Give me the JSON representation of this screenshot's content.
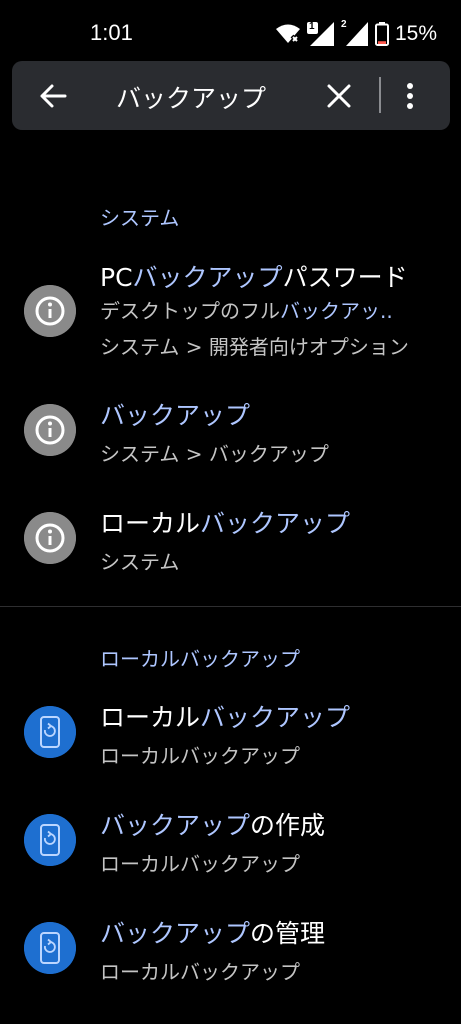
{
  "status_bar": {
    "time": "1:01",
    "battery_percent": "15%",
    "sim1_label": "1",
    "sim2_label": "2",
    "icons": [
      "wifi-icon",
      "signal-icon",
      "signal-icon",
      "battery-low-icon"
    ],
    "battery_level": 0.15,
    "battery_color": "#ff5b4f"
  },
  "search": {
    "query": "バックアップ",
    "back_icon": "arrow-back-icon",
    "clear_icon": "close-icon",
    "more_icon": "more-vert-icon"
  },
  "colors": {
    "highlight": "#aec6ff",
    "info_icon_bg": "#8a8a8a",
    "backup_icon_bg": "#1e6fd0",
    "background": "#000000",
    "search_bg": "#2a2c30"
  },
  "sections": [
    {
      "header": "システム",
      "items": [
        {
          "icon": "info-icon",
          "title_pre": "PC",
          "title_hl": "バックアップ",
          "title_post": "パスワード",
          "sub1_pre": "デスクトップのフル",
          "sub1_hl": "バックアッ..",
          "sub2": "システム > 開発者向けオプション"
        },
        {
          "icon": "info-icon",
          "title_pre": "",
          "title_hl": "バックアップ",
          "title_post": "",
          "sub": "システム > バックアップ"
        },
        {
          "icon": "info-icon",
          "title_pre": "ローカル",
          "title_hl": "バックアップ",
          "title_post": "",
          "sub": "システム"
        }
      ]
    },
    {
      "header": "ローカルバックアップ",
      "items": [
        {
          "icon": "phone-restore-icon",
          "title_pre": "ローカル",
          "title_hl": "バックアップ",
          "title_post": "",
          "sub": "ローカルバックアップ"
        },
        {
          "icon": "phone-restore-icon",
          "title_pre": "",
          "title_hl": "バックアップ",
          "title_post": "の作成",
          "sub": "ローカルバックアップ"
        },
        {
          "icon": "phone-restore-icon",
          "title_pre": "",
          "title_hl": "バックアップ",
          "title_post": "の管理",
          "sub": "ローカルバックアップ"
        }
      ]
    }
  ]
}
